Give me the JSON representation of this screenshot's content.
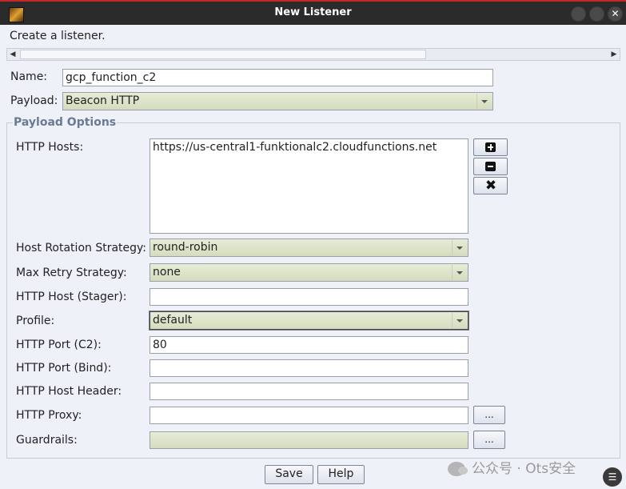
{
  "window": {
    "title": "New Listener",
    "controls": [
      "minimize",
      "maximize",
      "close"
    ],
    "close_glyph": "✕"
  },
  "description": "Create a listener.",
  "name": {
    "label": "Name:",
    "value": "gcp_function_c2"
  },
  "payload": {
    "label": "Payload:",
    "value": "Beacon HTTP"
  },
  "payload_options": {
    "legend": "Payload Options",
    "http_hosts": {
      "label": "HTTP Hosts:",
      "value": "https://us-central1-funktionalc2.cloudfunctions.net"
    },
    "host_rotation": {
      "label": "Host Rotation Strategy:",
      "value": "round-robin"
    },
    "max_retry": {
      "label": "Max Retry Strategy:",
      "value": "none"
    },
    "host_stager": {
      "label": "HTTP Host (Stager):",
      "value": ""
    },
    "profile": {
      "label": "Profile:",
      "value": "default"
    },
    "port_c2": {
      "label": "HTTP Port (C2):",
      "value": "80"
    },
    "port_bind": {
      "label": "HTTP Port (Bind):",
      "value": ""
    },
    "host_header": {
      "label": "HTTP Host Header:",
      "value": ""
    },
    "proxy": {
      "label": "HTTP Proxy:",
      "value": "",
      "button": "..."
    },
    "guardrails": {
      "label": "Guardrails:",
      "value": "",
      "button": "..."
    }
  },
  "buttons": {
    "save": "Save",
    "help": "Help"
  },
  "watermark": "公众号 · Ots安全",
  "icons": [
    "app-icon",
    "plus-icon",
    "minus-icon",
    "remove-icon",
    "wechat-icon",
    "chat-icon"
  ],
  "colors": {
    "title_accent": "#c62828",
    "legend": "#6a7a94",
    "combo_fill": "#dfe5cc"
  }
}
